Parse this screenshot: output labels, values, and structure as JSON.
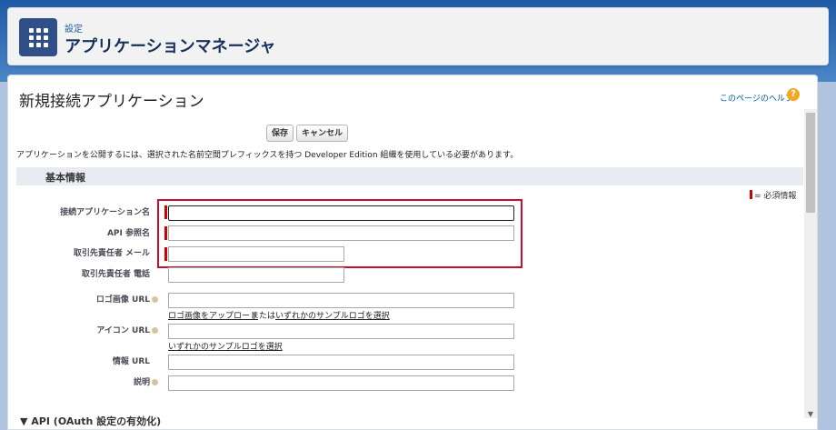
{
  "header": {
    "breadcrumb": "設定",
    "title": "アプリケーションマネージャ"
  },
  "page": {
    "heading": "新規接続アプリケーション",
    "help_link": "このページのヘルプ",
    "help_icon": "?"
  },
  "toolbar": {
    "save_label": "保存",
    "cancel_label": "キャンセル"
  },
  "info_text": "アプリケーションを公開するには、選択された名前空間プレフィックスを持つ Developer Edition 組織を使用している必要があります。",
  "section": {
    "title": "基本情報",
    "required_legend": "= 必須情報"
  },
  "fields": {
    "connected_app_name": {
      "label": "接続アプリケーション名",
      "value": ""
    },
    "api_name": {
      "label": "API 参照名",
      "value": ""
    },
    "contact_email": {
      "label": "取引先責任者 メール",
      "value": ""
    },
    "contact_phone": {
      "label": "取引先責任者 電話",
      "value": ""
    },
    "logo_url": {
      "label": "ロゴ画像 URL",
      "value": "",
      "upload_link": "ロゴ画像をアップロード",
      "or_text": "または",
      "sample_link": "いずれかのサンプルロゴを選択"
    },
    "icon_url": {
      "label": "アイコン URL",
      "value": "",
      "sample_link": "いずれかのサンプルロゴを選択"
    },
    "info_url": {
      "label": "情報 URL",
      "value": ""
    },
    "description": {
      "label": "説明",
      "value": ""
    }
  },
  "next_section": "▼  API (OAuth 設定の有効化)",
  "colors": {
    "accent": "#2f4f86",
    "highlight": "#c8102e",
    "required": "#cc0000"
  }
}
